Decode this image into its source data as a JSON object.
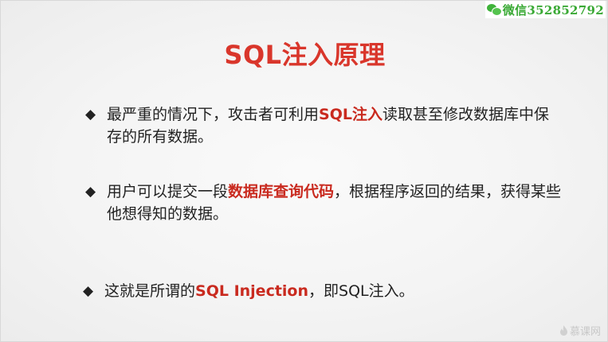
{
  "watermark": {
    "text": "微信352852792",
    "icon": "wechat-icon",
    "color": "#3aa935"
  },
  "slide": {
    "title": "SQL注入原理",
    "title_color": "#d9362b",
    "highlight_color": "#c92a1f",
    "bullets": [
      {
        "marker": "◆",
        "before": "最严重的情况下，攻击者可利用",
        "highlight": "SQL注入",
        "after": "读取甚至修改数据库中保存的所有数据。"
      },
      {
        "marker": "◆",
        "before": "用户可以提交一段",
        "highlight": "数据库查询代码",
        "after": "，根据程序返回的结果，获得某些他想得知的数据。"
      },
      {
        "marker": "◆",
        "before": "这就是所谓的",
        "highlight": "SQL Injection",
        "after": "，即SQL注入。"
      }
    ]
  },
  "logo": {
    "text": "慕课网",
    "icon": "flame-icon"
  }
}
